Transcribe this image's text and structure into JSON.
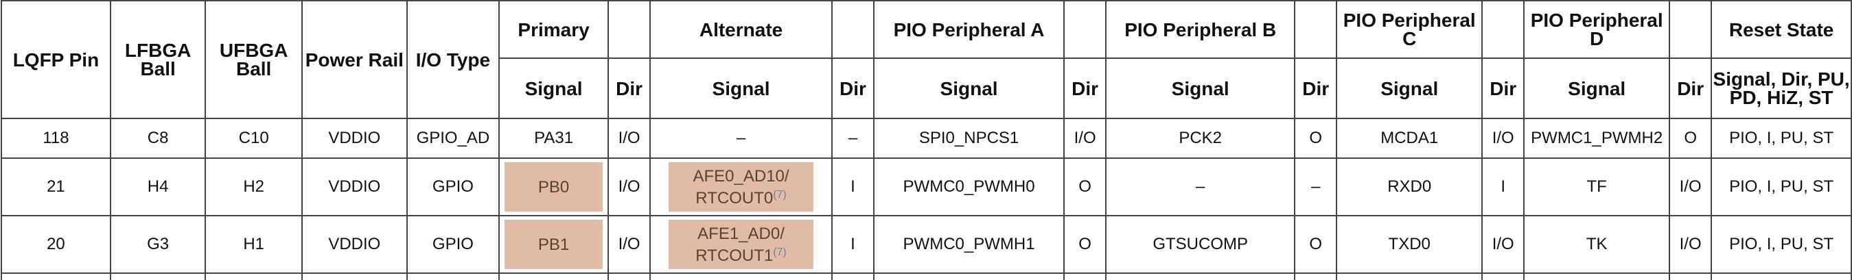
{
  "headers": {
    "lqfp_pin": "LQFP Pin",
    "lfbga_ball": "LFBGA Ball",
    "ufbga_ball": "UFBGA Ball",
    "power_rail": "Power Rail",
    "io_type": "I/O Type",
    "primary": "Primary",
    "alternate": "Alternate",
    "pio_a": "PIO Peripheral A",
    "pio_b": "PIO Peripheral B",
    "pio_c": "PIO Peripheral C",
    "pio_d": "PIO Peripheral D",
    "reset_state": "Reset State",
    "signal": "Signal",
    "dir": "Dir",
    "reset_sub": "Signal, Dir, PU, PD, HiZ, ST"
  },
  "rows": [
    {
      "lqfp": "118",
      "lfbga": "C8",
      "ufbga": "C10",
      "power": "VDDIO",
      "iotype": "GPIO_AD",
      "prim_sig": "PA31",
      "prim_dir": "I/O",
      "alt_sig1": "–",
      "alt_sig2": "",
      "alt_note": "",
      "alt_dir": "–",
      "a_sig": "SPI0_NPCS1",
      "a_dir": "I/O",
      "b_sig": "PCK2",
      "b_dir": "O",
      "c_sig": "MCDA1",
      "c_dir": "I/O",
      "d_sig": "PWMC1_PWMH2",
      "d_dir": "O",
      "reset": "PIO, I, PU, ST"
    },
    {
      "lqfp": "21",
      "lfbga": "H4",
      "ufbga": "H2",
      "power": "VDDIO",
      "iotype": "GPIO",
      "prim_sig": "PB0",
      "prim_dir": "I/O",
      "alt_sig1": "AFE0_AD10/",
      "alt_sig2": "RTCOUT0",
      "alt_note": "(7)",
      "alt_dir": "I",
      "a_sig": "PWMC0_PWMH0",
      "a_dir": "O",
      "b_sig": "–",
      "b_dir": "–",
      "c_sig": "RXD0",
      "c_dir": "I",
      "d_sig": "TF",
      "d_dir": "I/O",
      "reset": "PIO, I, PU, ST"
    },
    {
      "lqfp": "20",
      "lfbga": "G3",
      "ufbga": "H1",
      "power": "VDDIO",
      "iotype": "GPIO",
      "prim_sig": "PB1",
      "prim_dir": "I/O",
      "alt_sig1": "AFE1_AD0/",
      "alt_sig2": "RTCOUT1",
      "alt_note": "(7)",
      "alt_dir": "I",
      "a_sig": "PWMC0_PWMH1",
      "a_dir": "O",
      "b_sig": "GTSUCOMP",
      "b_dir": "O",
      "c_sig": "TXD0",
      "c_dir": "I/O",
      "d_sig": "TK",
      "d_dir": "I/O",
      "reset": "PIO, I, PU, ST"
    }
  ],
  "colors": {
    "highlight": "#e2bba7",
    "border": "#444444",
    "note": "#6f7fa8"
  }
}
